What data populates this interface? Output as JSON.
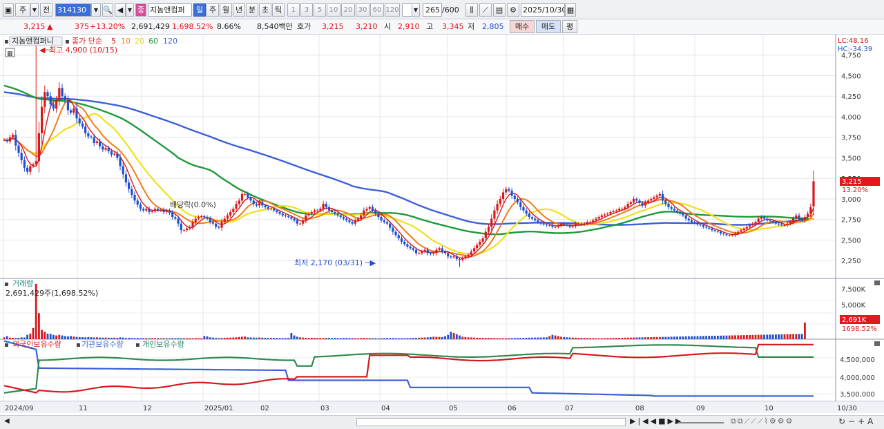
{
  "toolbar": {
    "period_label": "주",
    "compare_label": "전",
    "code": "314130",
    "name": "지놈앤컴퍼",
    "tag": "종",
    "range_value": "265",
    "range_max": "/600",
    "date": "2025/10/30",
    "unit_tabs": [
      "일",
      "주",
      "월",
      "년",
      "분",
      "초",
      "틱"
    ],
    "active_unit": "일",
    "minute_tabs": [
      "1",
      "3",
      "5",
      "10",
      "20",
      "30",
      "60",
      "120"
    ]
  },
  "quote": {
    "price": "3,215",
    "change": "375",
    "change_pct": "+13.20%",
    "volume": "2,691,429",
    "vol_pct": "1,698.52%",
    "turnover": "8.66%",
    "amount": "8,540백만",
    "ask_label": "호가",
    "ask": "3,215",
    "bid": "3,210",
    "open_label": "시",
    "open": "2,910",
    "high_label": "고",
    "high": "3,345",
    "low_label": "저",
    "low": "2,805",
    "buy_label": "매수",
    "sell_label": "매도",
    "avg_label": "평"
  },
  "price_panel": {
    "title": "지놈앤컴퍼니",
    "ma_label": "종가 단순",
    "ma_periods": [
      "5",
      "10",
      "20",
      "60",
      "120"
    ],
    "ma_colors": [
      "#d7191c",
      "#ef7d1a",
      "#f0e01a",
      "#1d9a3a",
      "#3d5fd8"
    ],
    "high_note": "최고 4,900 (10/15)",
    "low_note": "최저 2,170 (03/31)",
    "dividend_note": "배당락(0.0%)",
    "lc": "LC:48.16",
    "hc": "HC:-34.39",
    "last_price": "3,215",
    "last_pct": "13.20%",
    "yticks": [
      "4,750",
      "4,500",
      "4,250",
      "4,000",
      "3,750",
      "3,500",
      "3,250",
      "3,000",
      "2,750",
      "2,500",
      "2,250"
    ]
  },
  "volume_panel": {
    "title": "거래량",
    "value": "2,691,429주(1,698.52%)",
    "yticks": [
      "7,500K",
      "5,000K",
      "2,500K"
    ],
    "last": "2,691K",
    "last_pct": "1698.52%"
  },
  "holdings_panel": {
    "foreign_label": "외국인보유수량",
    "inst_label": "기관보유수량",
    "indiv_label": "개인보유수량",
    "yticks": [
      "4,500,000",
      "4,000,000",
      "3,500,000"
    ]
  },
  "xaxis": {
    "labels": [
      "2024/09",
      "11",
      "12",
      "2025/01",
      "02",
      "03",
      "04",
      "05",
      "06",
      "07",
      "08",
      "09",
      "10",
      "10/30"
    ]
  },
  "chart_data": {
    "type": "candlestick",
    "ylim": [
      2050,
      5000
    ],
    "high": 4900,
    "low": 2170,
    "last": 3215,
    "closes": [
      3720,
      3700,
      3750,
      3780,
      3650,
      3560,
      3470,
      3380,
      3330,
      3400,
      3420,
      3460,
      3800,
      4120,
      4300,
      4250,
      4150,
      4100,
      4200,
      4350,
      4250,
      4200,
      4080,
      4050,
      4100,
      3980,
      3920,
      3880,
      3800,
      3760,
      3750,
      3680,
      3700,
      3640,
      3600,
      3620,
      3580,
      3540,
      3550,
      3500,
      3400,
      3300,
      3200,
      3120,
      3050,
      2980,
      2930,
      2880,
      2860,
      2880,
      2840,
      2850,
      2880,
      2860,
      2870,
      2840,
      2860,
      2830,
      2780,
      2760,
      2700,
      2620,
      2620,
      2640,
      2660,
      2720,
      2760,
      2780,
      2790,
      2780,
      2760,
      2720,
      2700,
      2660,
      2650,
      2720,
      2760,
      2800,
      2840,
      2880,
      2940,
      2980,
      3060,
      3060,
      3020,
      2980,
      2940,
      2920,
      2960,
      2920,
      2900,
      2880,
      2880,
      2860,
      2840,
      2820,
      2800,
      2790,
      2780,
      2760,
      2740,
      2700,
      2700,
      2740,
      2800,
      2820,
      2840,
      2860,
      2860,
      2880,
      2940,
      2900,
      2860,
      2840,
      2820,
      2800,
      2780,
      2760,
      2740,
      2720,
      2700,
      2740,
      2760,
      2800,
      2860,
      2880,
      2900,
      2860,
      2820,
      2780,
      2740,
      2720,
      2700,
      2650,
      2600,
      2560,
      2520,
      2480,
      2450,
      2420,
      2400,
      2380,
      2340,
      2340,
      2360,
      2380,
      2340,
      2330,
      2340,
      2380,
      2400,
      2360,
      2340,
      2300,
      2290,
      2300,
      2270,
      2260,
      2280,
      2300,
      2320,
      2360,
      2400,
      2440,
      2480,
      2520,
      2600,
      2660,
      2760,
      2860,
      2940,
      3000,
      3080,
      3120,
      3100,
      3040,
      3000,
      2960,
      2900,
      2860,
      2820,
      2780,
      2760,
      2740,
      2720,
      2700,
      2690,
      2680,
      2680,
      2660,
      2660,
      2680,
      2700,
      2690,
      2680,
      2660,
      2670,
      2700,
      2700,
      2690,
      2700,
      2720,
      2720,
      2740,
      2760,
      2780,
      2800,
      2810,
      2820,
      2840,
      2850,
      2860,
      2880,
      2880,
      2900,
      2940,
      2960,
      3000,
      2980,
      2950,
      2920,
      2960,
      2980,
      3000,
      3020,
      3040,
      3060,
      2980,
      2940,
      2900,
      2880,
      2860,
      2840,
      2820,
      2800,
      2760,
      2740,
      2720,
      2710,
      2690,
      2680,
      2660,
      2650,
      2640,
      2620,
      2610,
      2600,
      2580,
      2570,
      2560,
      2560,
      2560,
      2580,
      2600,
      2620,
      2640,
      2660,
      2680,
      2700,
      2720,
      2760,
      2780,
      2760,
      2740,
      2730,
      2720,
      2700,
      2690,
      2680,
      2680,
      2700,
      2720,
      2760,
      2800,
      2760,
      2740,
      2780,
      2820,
      2900,
      3215
    ],
    "volume": [
      300,
      500,
      250,
      220,
      200,
      220,
      300,
      280,
      700,
      900,
      1800,
      8900,
      4200,
      1500,
      1200,
      900,
      850,
      700,
      600,
      700,
      600,
      500,
      450,
      500,
      420,
      380,
      350,
      330,
      300,
      350,
      320,
      280,
      300,
      260,
      250,
      260,
      240,
      230,
      250,
      220,
      300,
      260,
      200,
      210,
      190,
      180,
      200,
      170,
      160,
      180,
      150,
      160,
      170,
      160,
      150,
      170,
      150,
      140,
      160,
      150,
      180,
      170,
      160,
      150,
      170,
      160,
      180,
      170,
      160,
      500,
      450,
      300,
      250,
      200,
      180,
      200,
      220,
      240,
      260,
      280,
      300,
      350,
      400,
      420,
      300,
      280,
      260,
      240,
      280,
      250,
      230,
      200,
      210,
      200,
      190,
      180,
      170,
      180,
      200,
      1000,
      600,
      400,
      300,
      250,
      220,
      200,
      230,
      210,
      200,
      190,
      180,
      200,
      210,
      190,
      200,
      180,
      170,
      190,
      200,
      180,
      170,
      160,
      150,
      190,
      200,
      180,
      170,
      160,
      150,
      140,
      160,
      180,
      200,
      190,
      180,
      170,
      160,
      150,
      160,
      170,
      180,
      200,
      220,
      240,
      260,
      280,
      300,
      350,
      400,
      380,
      360,
      340,
      500,
      700,
      1200,
      1000,
      800,
      600,
      400,
      350,
      300,
      280,
      260,
      240,
      230,
      220,
      210,
      200,
      190,
      180,
      170,
      160,
      150,
      160,
      170,
      180,
      190,
      200,
      210,
      220,
      230,
      240,
      250,
      260,
      270,
      280,
      290,
      300,
      500,
      700,
      600,
      500,
      400,
      350,
      300,
      280,
      260,
      240,
      220,
      210,
      200,
      190,
      180,
      170,
      160,
      150,
      160,
      170,
      180,
      190,
      200,
      210,
      220,
      230,
      240,
      250,
      260,
      270,
      280,
      290,
      300,
      310,
      320,
      330,
      340,
      350,
      360,
      370,
      380,
      390,
      400,
      410,
      420,
      430,
      440,
      450,
      460,
      470,
      480,
      490,
      500,
      510,
      520,
      530,
      540,
      550,
      560,
      570,
      580,
      590,
      600,
      610,
      620,
      630,
      640,
      650,
      660,
      670,
      680,
      690,
      700,
      710,
      720,
      730,
      740,
      750,
      760,
      770,
      780,
      790,
      800,
      810,
      820,
      830,
      840,
      850,
      2691
    ]
  }
}
